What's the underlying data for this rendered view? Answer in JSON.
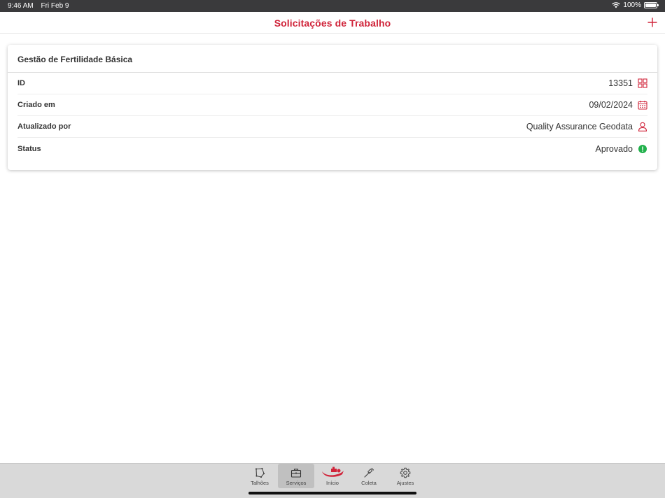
{
  "status_bar": {
    "time": "9:46 AM",
    "date": "Fri Feb 9",
    "battery": "100%",
    "icons": [
      "wifi-icon",
      "battery-icon"
    ]
  },
  "nav": {
    "title": "Solicitações de Trabalho",
    "add_icon": "plus-icon"
  },
  "card": {
    "title": "Gestão de Fertilidade Básica",
    "rows": [
      {
        "label": "ID",
        "value": "13351",
        "icon": "grid-icon"
      },
      {
        "label": "Criado em",
        "value": "09/02/2024",
        "icon": "calendar-icon"
      },
      {
        "label": "Atualizado por",
        "value": "Quality Assurance Geodata",
        "icon": "user-icon"
      },
      {
        "label": "Status",
        "value": "Aprovado",
        "icon": "status-dot-icon"
      }
    ]
  },
  "tabs": [
    {
      "label": "Talhões",
      "icon": "field-polygon-icon"
    },
    {
      "label": "Serviços",
      "icon": "briefcase-icon",
      "active": true
    },
    {
      "label": "Início",
      "icon": "tractor-logo-icon"
    },
    {
      "label": "Coleta",
      "icon": "probe-icon"
    },
    {
      "label": "Ajustes",
      "icon": "gear-icon"
    }
  ],
  "colors": {
    "accent": "#d0243a",
    "status_approved": "#22b14c",
    "tab_bar_bg": "#d9d9d9",
    "status_bar_bg": "#3a3a3c"
  }
}
